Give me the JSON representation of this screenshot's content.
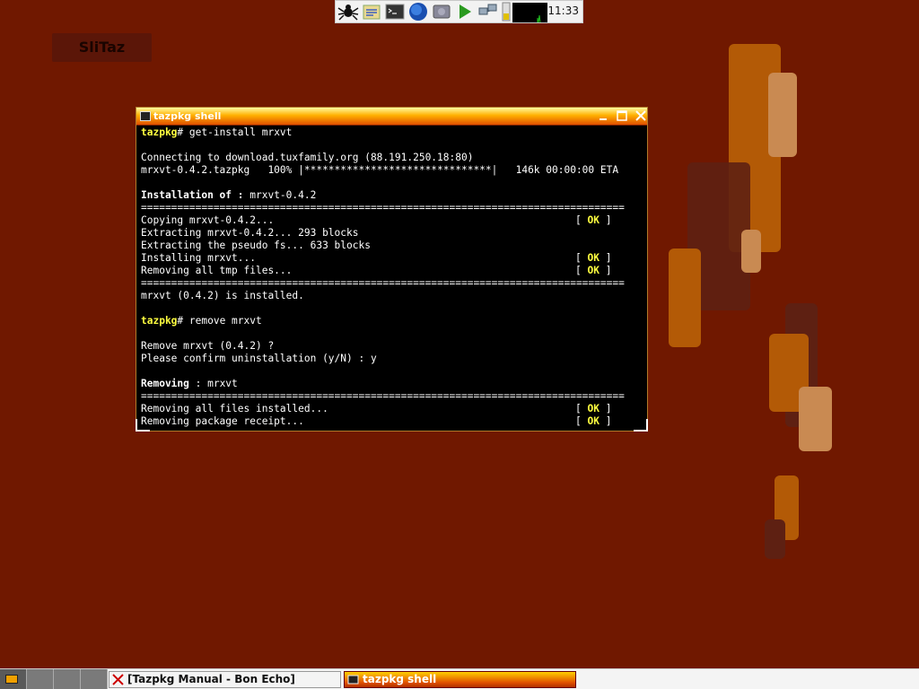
{
  "desktop": {
    "label": "SliTaz"
  },
  "top_panel": {
    "icons": [
      "spider-icon",
      "editor-icon",
      "terminal-icon",
      "firefox-globe-icon",
      "image-viewer-icon",
      "play-icon",
      "network-icon",
      "battery-icon",
      "cpu-monitor-icon"
    ],
    "clock": "11:33"
  },
  "window": {
    "title": "tazpkg shell",
    "lines": [
      {
        "type": "prompt",
        "prompt": "tazpkg",
        "text": "# get-install mrxvt"
      },
      {
        "type": "text",
        "text": ""
      },
      {
        "type": "text",
        "text": "Connecting to download.tuxfamily.org (88.191.250.18:80)"
      },
      {
        "type": "text",
        "text": "mrxvt-0.4.2.tazpkg   100% |*******************************|   146k 00:00:00 ETA"
      },
      {
        "type": "text",
        "text": ""
      },
      {
        "type": "boldlabel",
        "label": "Installation of :",
        "text": " mrxvt-0.4.2"
      },
      {
        "type": "sep",
        "text": "================================================================================"
      },
      {
        "type": "ok",
        "text": "Copying mrxvt-0.4.2..."
      },
      {
        "type": "text",
        "text": "Extracting mrxvt-0.4.2... 293 blocks"
      },
      {
        "type": "text",
        "text": "Extracting the pseudo fs... 633 blocks"
      },
      {
        "type": "ok",
        "text": "Installing mrxvt..."
      },
      {
        "type": "ok",
        "text": "Removing all tmp files..."
      },
      {
        "type": "sep",
        "text": "================================================================================"
      },
      {
        "type": "text",
        "text": "mrxvt (0.4.2) is installed."
      },
      {
        "type": "text",
        "text": ""
      },
      {
        "type": "prompt",
        "prompt": "tazpkg",
        "text": "# remove mrxvt"
      },
      {
        "type": "text",
        "text": ""
      },
      {
        "type": "text",
        "text": "Remove mrxvt (0.4.2) ?"
      },
      {
        "type": "text",
        "text": "Please confirm uninstallation (y/N) : y"
      },
      {
        "type": "text",
        "text": ""
      },
      {
        "type": "boldlabel",
        "label": "Removing",
        "text": " : mrxvt"
      },
      {
        "type": "sep",
        "text": "================================================================================"
      },
      {
        "type": "ok",
        "text": "Removing all files installed..."
      },
      {
        "type": "ok",
        "text": "Removing package receipt..."
      }
    ],
    "ok_label": "OK"
  },
  "taskbar": {
    "tasks": [
      {
        "label": "[Tazpkg Manual - Bon Echo]",
        "icon": "firefox-x-icon"
      },
      {
        "label": "tazpkg shell",
        "icon": "terminal-icon"
      }
    ]
  }
}
